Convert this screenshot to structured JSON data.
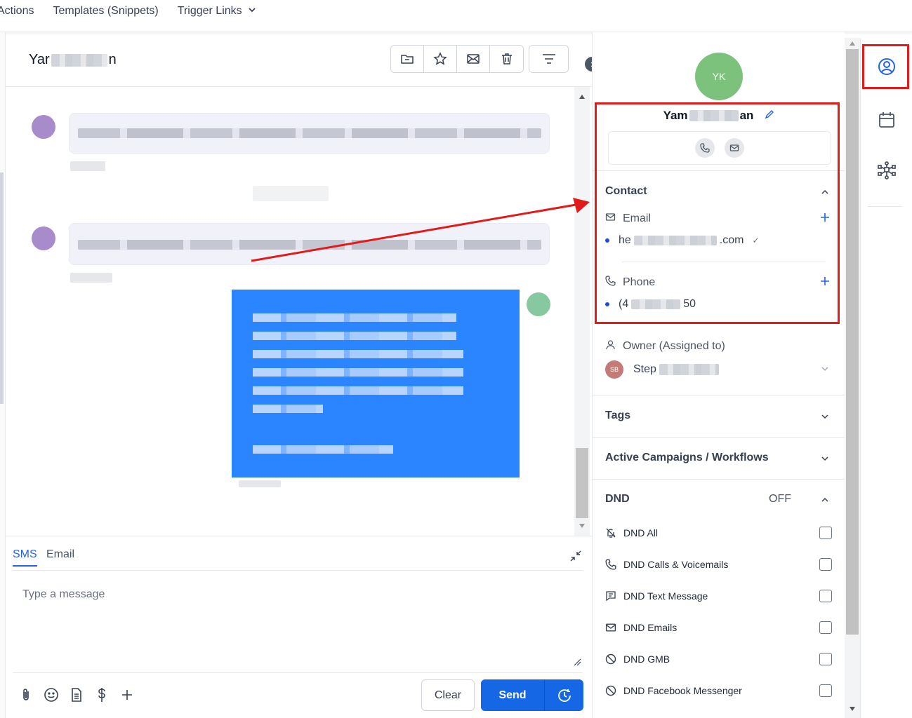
{
  "topnav": {
    "items": [
      "Actions",
      "Templates (Snippets)",
      "Trigger Links"
    ]
  },
  "conversation": {
    "contact_name_visible": "Yar",
    "contact_name_end": "n",
    "toolbar_icons": [
      "folder-icon",
      "star-icon",
      "mail-icon",
      "trash-icon"
    ],
    "filter_icon": "filter-icon"
  },
  "composer": {
    "tabs": [
      "SMS",
      "Email"
    ],
    "active_tab": "SMS",
    "placeholder": "Type a message",
    "clear_label": "Clear",
    "send_label": "Send",
    "tool_icons": [
      "paperclip-icon",
      "emoji-icon",
      "document-icon",
      "dollar-icon",
      "plus-icon"
    ]
  },
  "panel": {
    "avatar_initials": "YK",
    "name_start": "Yam",
    "name_end": "an",
    "contact_section": "Contact",
    "email_label": "Email",
    "email_start": "he",
    "email_end": ".com",
    "email_verified_mark": "✓",
    "phone_label": "Phone",
    "phone_start": "(4",
    "phone_end": "50",
    "owner_label": "Owner (Assigned to)",
    "owner_initials": "SB",
    "owner_name_start": "Step",
    "tags": "Tags",
    "campaigns": "Active Campaigns / Workflows",
    "dnd": "DND",
    "dnd_status": "OFF",
    "dnd_options": [
      "DND All",
      "DND Calls & Voicemails",
      "DND Text Message",
      "DND Emails",
      "DND GMB",
      "DND Facebook Messenger"
    ]
  },
  "rail": {
    "icons": [
      "user-circle-icon",
      "calendar-icon",
      "network-icon"
    ]
  },
  "colors": {
    "accent": "#1667e5",
    "avatar_green": "#7cc27d",
    "annotation_red": "#e21a1a",
    "outgoing_bubble": "#2a85ff"
  }
}
